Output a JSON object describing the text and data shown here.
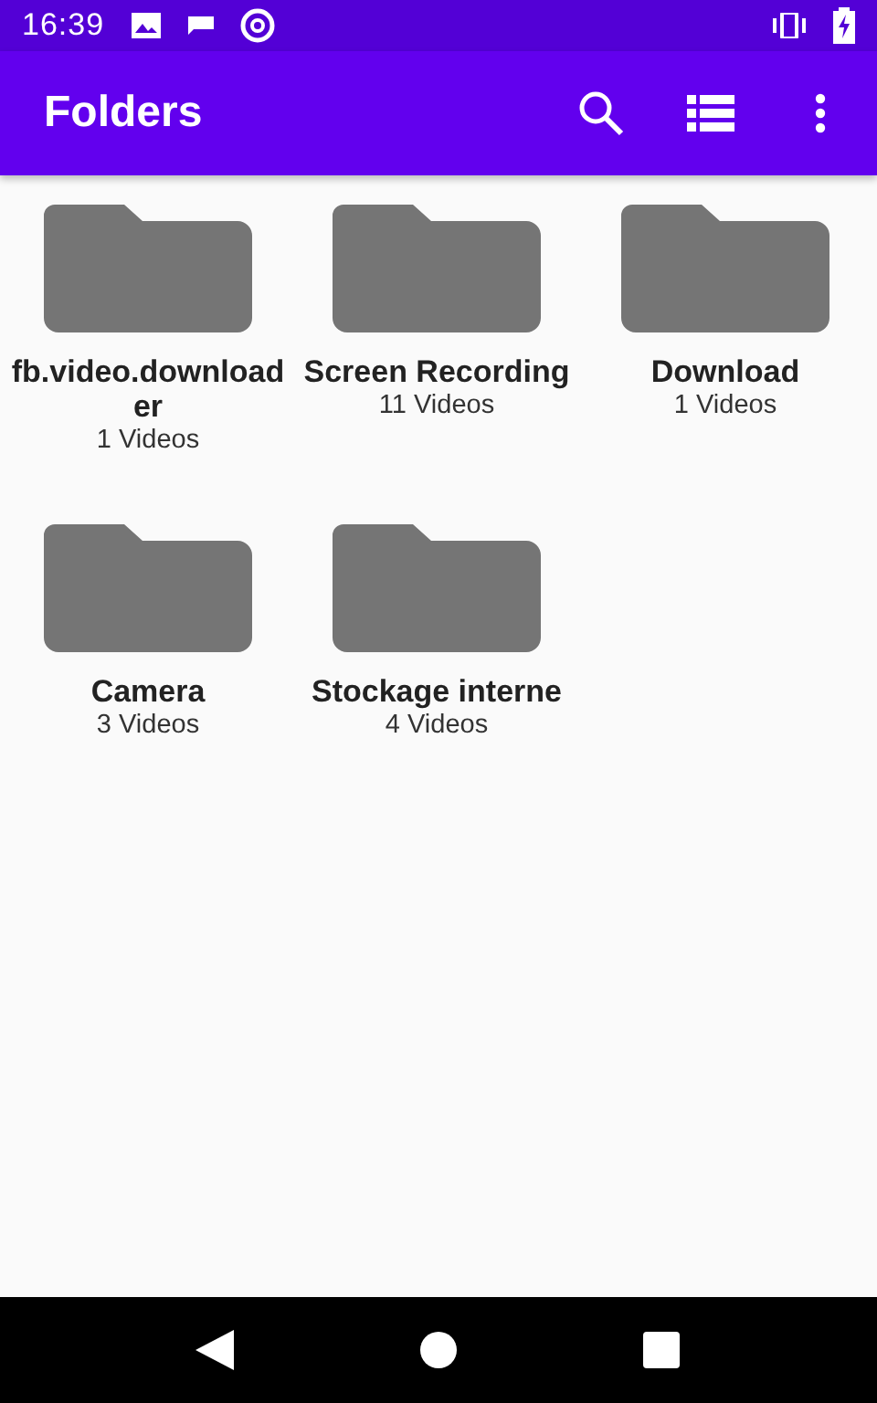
{
  "status_bar": {
    "time": "16:39"
  },
  "app_bar": {
    "title": "Folders"
  },
  "folders": [
    {
      "name": "fb.video.downloader",
      "count": "1 Videos"
    },
    {
      "name": "Screen Recording",
      "count": "11 Videos"
    },
    {
      "name": "Download",
      "count": "1 Videos"
    },
    {
      "name": "Camera",
      "count": "3 Videos"
    },
    {
      "name": "Stockage interne",
      "count": "4 Videos"
    }
  ]
}
